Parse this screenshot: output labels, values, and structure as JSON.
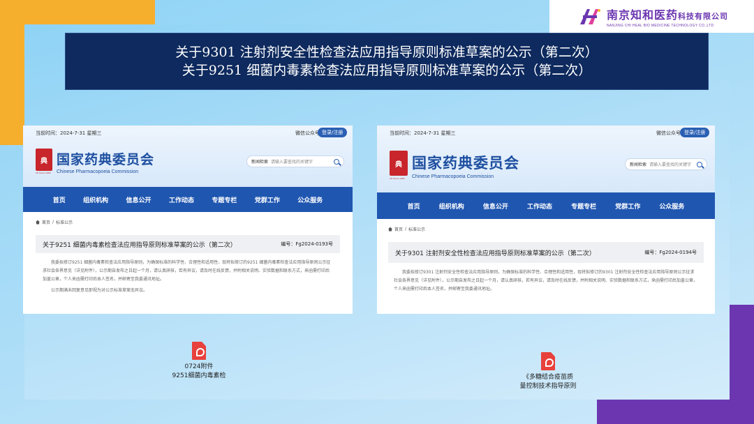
{
  "logo": {
    "name_cn": "南京知和医药",
    "name_cn_suffix": "科技有限公司",
    "name_en": "NANJING CHI HEAL BIO MEDICINE TECHNOLOGY CO.,LTD",
    "mark_letters": "H"
  },
  "title": {
    "line1": "关于9301 注射剂安全性检查法应用指导原则标准草案的公示（第二次）",
    "line2": "关于9251 细菌内毒素检查法应用指导原则标准草案的公示（第二次）"
  },
  "screenshots": [
    {
      "date": "当前时间：2024-7-31 星期三",
      "wechat": "微信公众号",
      "login": "登录/注册",
      "emblem": "典",
      "emblem_caption": "CP Since 1950",
      "org_cn": "国家药典委员会",
      "org_en": "Chinese Pharmacopoeia Commission",
      "search_select": "新闻检索",
      "search_placeholder": "请输入要查找的关键字",
      "nav": [
        "首页",
        "组织机构",
        "信息公开",
        "工作动态",
        "专题专栏",
        "党群工作",
        "公众服务"
      ],
      "breadcrumb": [
        "首页",
        "标准公示"
      ],
      "doc_title": "关于9251 细菌内毒素检查法应用指导原则标准草案的公示（第二次）",
      "doc_no": "编号：Fg2024-0193号",
      "body": "我委拟修订9251 细菌内毒素检查法应用指导原则，为确保标准的科学性、合理性和适用性，现将拟修订的9251 细菌内毒素检查法应用指导原则公示征求社会各界意见（详见附件），公示期自发布之日起一个月，请认真研核，若有异议，请及时在线反馈，并附相关说明、实验数据和联系方式，来函需打印后加盖公章，个人来函需打印后本人签名，并邮寄至我委通讯地址。",
      "body2": "公示期满未回复意见即视为对公示标准草案无异议。"
    },
    {
      "date": "当前时间：2024-7-31 星期三",
      "wechat": "微信公众号",
      "login": "登录/注册",
      "emblem": "典",
      "emblem_caption": "CP Since 1950",
      "org_cn": "国家药典委员会",
      "org_en": "Chinese Pharmacopoeia Commission",
      "search_select": "新闻检索",
      "search_placeholder": "请输入要查找的关键字",
      "nav": [
        "首页",
        "组织机构",
        "信息公开",
        "工作动态",
        "专题专栏",
        "党群工作",
        "公众服务"
      ],
      "breadcrumb": [
        "首页",
        "标准公示"
      ],
      "doc_title": "关于9301 注射剂安全性检查法应用指导原则标准草案的公示（第二次）",
      "doc_no": "编号：Fg2024-0194号",
      "body": "我委拟修订9301 注射剂安全性检查法应用指导原则，为确保标准的科学性、合理性和适用性，现将拟修订的9301 注射剂安全性检查法应用指导原则公示征求社会各界意见（详见附件），公示期自发布之日起一个月，请认真研核，若有异议，请及时在线反馈，并附相关说明、实验数据和联系方式，来函需打印后加盖公章，个人来函需打印后本人签名，并邮寄至我委通讯地址。"
    }
  ],
  "files": [
    {
      "line1": "0724附件",
      "line2": "9251细菌内毒素检"
    },
    {
      "line1": "《多糖结合疫苗质",
      "line2": "量控制技术指导原则"
    }
  ],
  "colors": {
    "title_band": "#0e2a5e",
    "nav_blue": "#1f56b0",
    "accent_orange": "#f6ae2d",
    "accent_purple": "#6b36b0",
    "pdf_red": "#e8403c"
  }
}
